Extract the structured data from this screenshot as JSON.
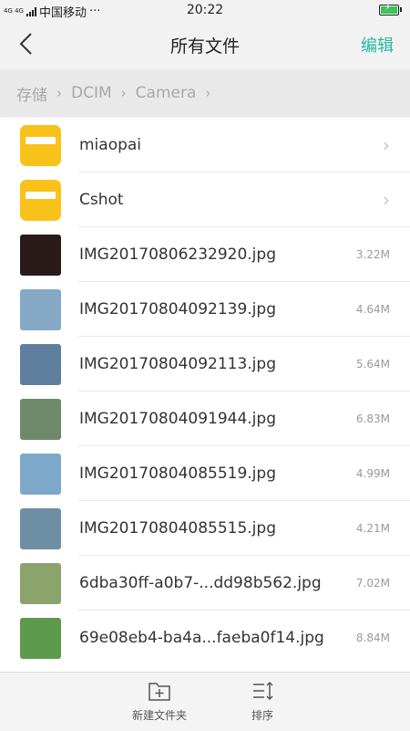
{
  "status": {
    "network_type": "4G 4G",
    "carrier": "中国移动",
    "dots": "···",
    "time": "20:22"
  },
  "header": {
    "title": "所有文件",
    "edit_label": "编辑"
  },
  "breadcrumb": [
    "存储",
    "DCIM",
    "Camera"
  ],
  "files": [
    {
      "name": "miaopai",
      "type": "folder",
      "size": ""
    },
    {
      "name": "Cshot",
      "type": "folder",
      "size": ""
    },
    {
      "name": "IMG20170806232920.jpg",
      "type": "image",
      "size": "3.22M",
      "thumb": "#2a1a1a"
    },
    {
      "name": "IMG20170804092139.jpg",
      "type": "image",
      "size": "4.64M",
      "thumb": "#86a9c6"
    },
    {
      "name": "IMG20170804092113.jpg",
      "type": "image",
      "size": "5.64M",
      "thumb": "#5f7f9f"
    },
    {
      "name": "IMG20170804091944.jpg",
      "type": "image",
      "size": "6.83M",
      "thumb": "#6e8a6a"
    },
    {
      "name": "IMG20170804085519.jpg",
      "type": "image",
      "size": "4.99M",
      "thumb": "#7ea8c9"
    },
    {
      "name": "IMG20170804085515.jpg",
      "type": "image",
      "size": "4.21M",
      "thumb": "#6d8ea3"
    },
    {
      "name": "6dba30ff-a0b7-...dd98b562.jpg",
      "type": "image",
      "size": "7.02M",
      "thumb": "#8aa46c"
    },
    {
      "name": "69e08eb4-ba4a...faeba0f14.jpg",
      "type": "image",
      "size": "8.84M",
      "thumb": "#5e9a4e"
    }
  ],
  "bottom": {
    "new_folder_label": "新建文件夹",
    "sort_label": "排序"
  },
  "colors": {
    "accent": "#27b8a3",
    "folder": "#f9c21a"
  }
}
